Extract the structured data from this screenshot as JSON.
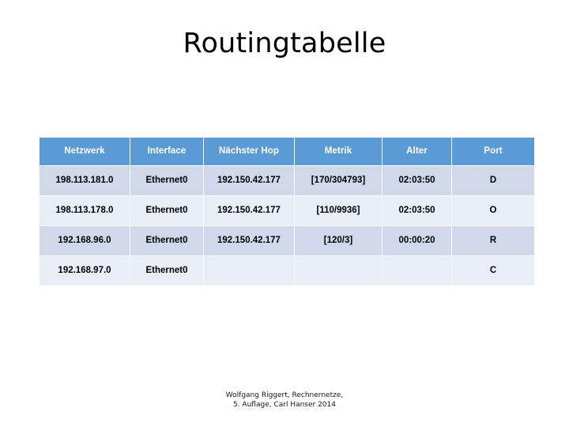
{
  "slide": {
    "title": "Routingtabelle",
    "background_color": "#FFFFFF"
  },
  "theme": {
    "header_background": "#5B9BD5",
    "header_text_color": "#FFFFFF",
    "row_band_dark": "#CFD9EA",
    "row_band_light": "#E9EDF5",
    "body_text_color": "#000000"
  },
  "table": {
    "columns": [
      {
        "label": "Netzwerk"
      },
      {
        "label": "Interface"
      },
      {
        "label": "Nächster Hop"
      },
      {
        "label": "Metrik"
      },
      {
        "label": "Alter"
      },
      {
        "label": "Port"
      }
    ],
    "rows": [
      {
        "netzwerk": "198.113.181.0",
        "interface": "Ethernet0",
        "naechster_hop": "192.150.42.177",
        "metrik": "[170/304793]",
        "alter": "02:03:50",
        "port": "D"
      },
      {
        "netzwerk": "198.113.178.0",
        "interface": "Ethernet0",
        "naechster_hop": "192.150.42.177",
        "metrik": "[110/9936]",
        "alter": "02:03:50",
        "port": "O"
      },
      {
        "netzwerk": "192.168.96.0",
        "interface": "Ethernet0",
        "naechster_hop": "192.150.42.177",
        "metrik": "[120/3]",
        "alter": "00:00:20",
        "port": "R"
      },
      {
        "netzwerk": "192.168.97.0",
        "interface": "Ethernet0",
        "naechster_hop": "",
        "metrik": "",
        "alter": "",
        "port": "C"
      }
    ]
  },
  "footer": {
    "line1": "Wolfgang Riggert, Rechnernetze,",
    "line2": "5. Auflage, Carl Hanser 2014"
  }
}
